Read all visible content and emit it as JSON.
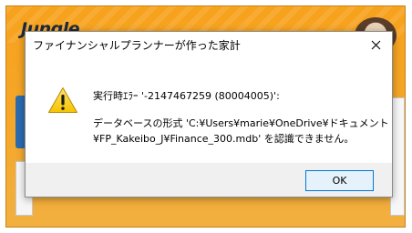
{
  "background_app": {
    "logo_text": "Jungle"
  },
  "dialog": {
    "title": "ファイナンシャルプランナーが作った家計",
    "close_icon": "close-icon",
    "warning_icon": "warning-icon",
    "message_line1": "実行時ｴﾗｰ '-2147467259 (80004005)':",
    "message_line2": "データベースの形式 'C:¥Users¥marie¥OneDrive¥ドキュメント",
    "message_line3": "¥FP_Kakeibo_J¥Finance_300.mdb' を認識できません。",
    "ok_label": "OK"
  },
  "colors": {
    "app_orange": "#f7a21c",
    "ok_border": "#0078d7",
    "ok_fill": "#e5f1fb",
    "warning_yellow": "#ffd21f"
  }
}
